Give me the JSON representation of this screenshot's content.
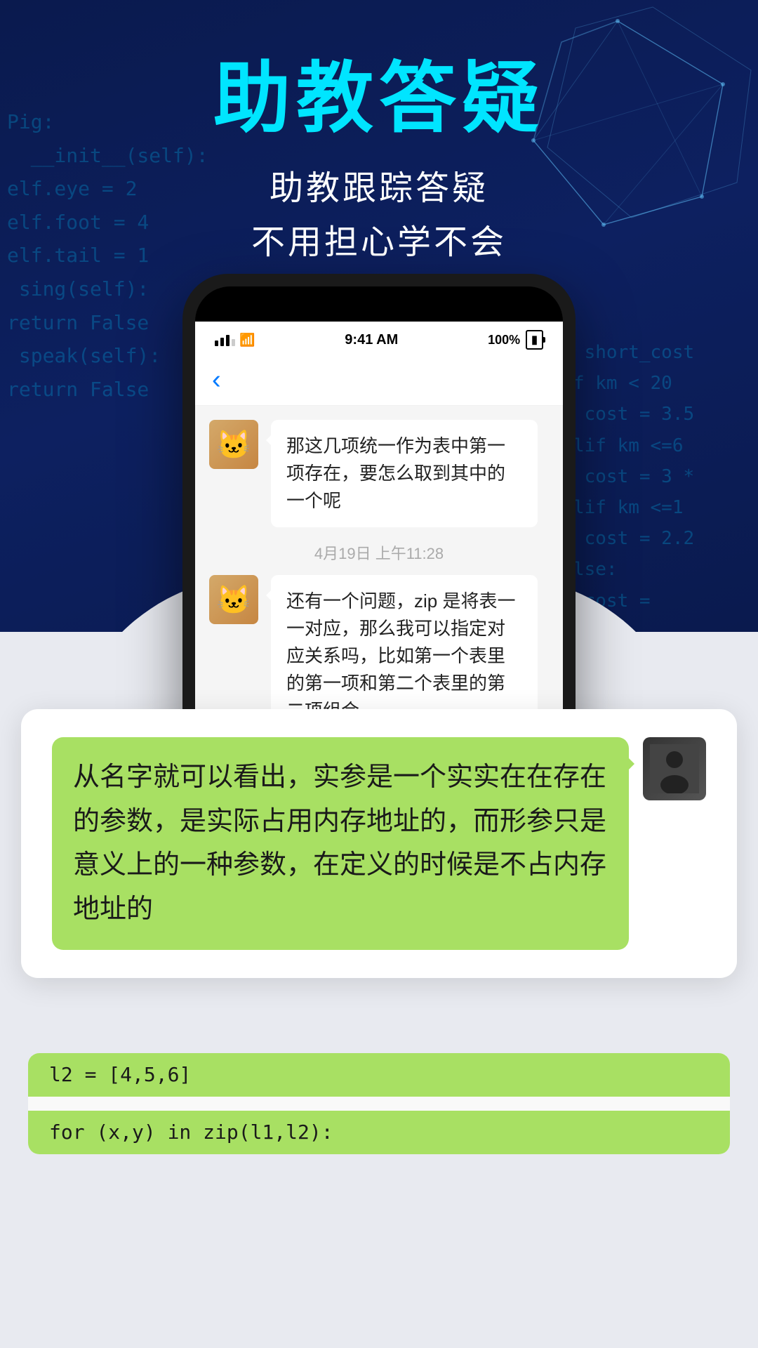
{
  "page": {
    "title": "助教答疑",
    "subtitle_line1": "助教跟踪答疑",
    "subtitle_line2": "不用担心学不会"
  },
  "code_bg_left": "Pig:\n  __init__(self):\nelf.eye = 2\nelf.foot = 4\nelf.tail = 1\n sing(self):\nreturn False\n speak(self):\nreturn False",
  "code_bg_right": "def short_cost\n  if km < 20\n    cost = 3.5\n  elif km <=6\n    cost = 3 *\n  elif km <=1\n    cost = 2.2\n  else:\n    cost =",
  "status_bar": {
    "time": "9:41 AM",
    "battery": "100%"
  },
  "chat": {
    "message1": {
      "text": "那这几项统一作为表中第一项存在，要怎么取到其中的一个呢",
      "avatar": "🐱"
    },
    "timestamp": "4月19日 上午11:28",
    "message2": {
      "text": "还有一个问题，zip 是将表一一对应，那么我可以指定对应关系吗，比如第一个表里的第一项和第二个表里的第二项组合",
      "avatar": "🐱"
    }
  },
  "ta_reply": {
    "text": "从名字就可以看出，实参是一个实实在在存在的参数，是实际占用内存地址的，而形参只是意义上的一种参数，在定义的时候是不占内存地址的",
    "avatar": "👤"
  },
  "code_bottom": {
    "line1": "l2 = [4,5,6]",
    "line2": "",
    "line3": "for (x,y) in zip(l1,l2):"
  },
  "colors": {
    "accent_cyan": "#00e5ff",
    "bg_dark": "#0a1a4e",
    "green_bubble": "#a8e063"
  }
}
